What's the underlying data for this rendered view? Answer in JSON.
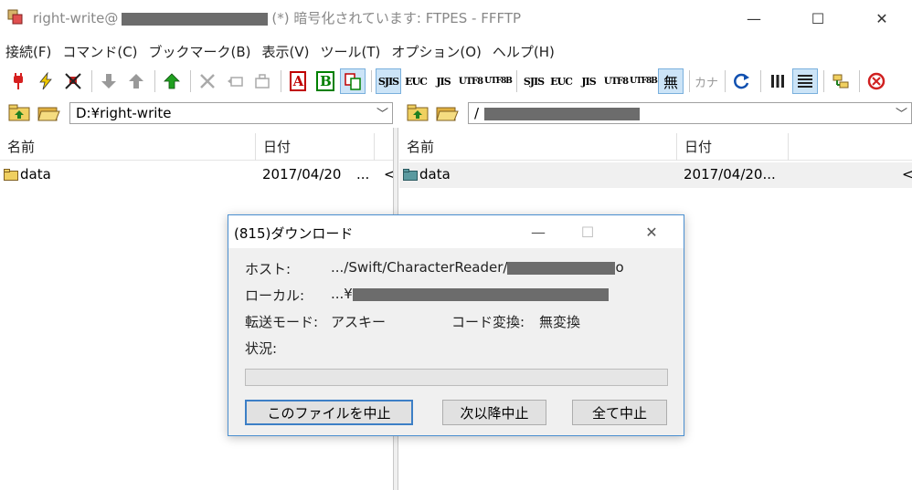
{
  "window": {
    "title_visible": "right-write@",
    "title_rest": "(*) 暗号化されています: FTPES - FFFTP",
    "controls": {
      "minimize": "—",
      "maximize": "☐",
      "close": "✕"
    }
  },
  "menu": [
    "接続(F)",
    "コマンド(C)",
    "ブックマーク(B)",
    "表示(V)",
    "ツール(T)",
    "オプション(O)",
    "ヘルプ(H)"
  ],
  "toolbar": {
    "mode_letters": [
      "A",
      "B"
    ],
    "kanji_codes_left": [
      "SJIS",
      "EUC",
      "JIS",
      "UTF8",
      "UTF8B"
    ],
    "kanji_codes_right": [
      "SJIS",
      "EUC",
      "JIS",
      "UTF8",
      "UTF8B"
    ],
    "no_convert": "無",
    "kana": "カナ"
  },
  "local": {
    "path": "D:¥right-write",
    "columns": [
      "名前",
      "日付"
    ],
    "rows": [
      {
        "name": "data",
        "date": "2017/04/20",
        "extra": "..."
      }
    ]
  },
  "remote": {
    "path": "/",
    "columns": [
      "名前",
      "日付"
    ],
    "rows": [
      {
        "name": "data",
        "date": "2017/04/20..."
      }
    ]
  },
  "dialog": {
    "title": "(815)ダウンロード",
    "host_label": "ホスト:",
    "host_value": ".../Swift/CharacterReader/",
    "host_suffix": "o",
    "local_label": "ローカル:",
    "local_value": "...¥",
    "mode_label": "転送モード:",
    "mode_value": "アスキー",
    "code_label": "コード変換:",
    "code_value": "無変換",
    "status_label": "状況:",
    "progress": 0,
    "buttons": {
      "abort_file": "このファイルを中止",
      "abort_next": "次以降中止",
      "abort_all": "全て中止"
    }
  }
}
